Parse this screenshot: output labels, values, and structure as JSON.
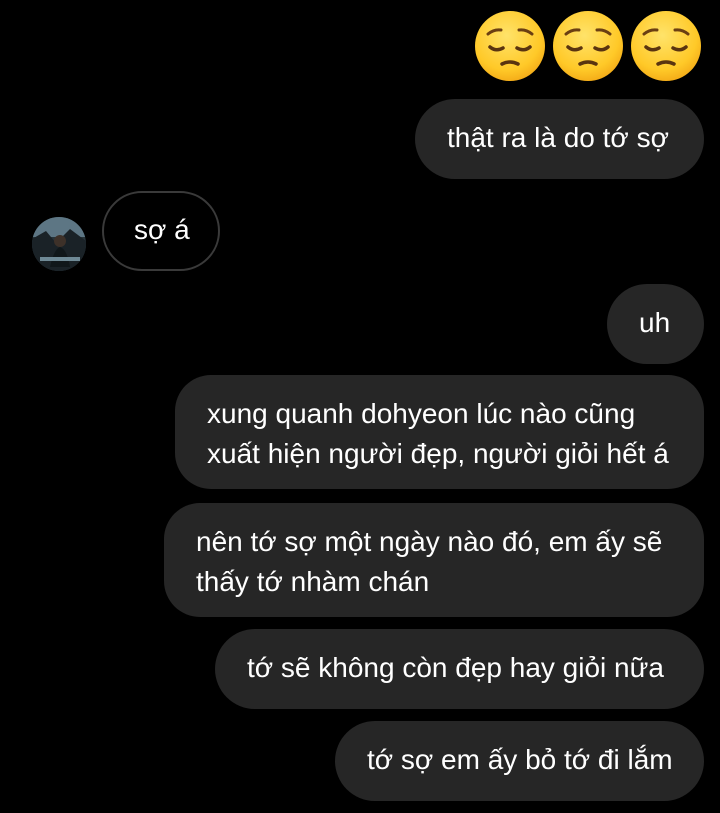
{
  "conversation": {
    "emoji_reaction": [
      "😔",
      "😔",
      "😔"
    ],
    "messages": [
      {
        "sender": "me",
        "text": "thật ra là do tớ sợ"
      },
      {
        "sender": "other",
        "text": "sợ á"
      },
      {
        "sender": "me",
        "text": "uh"
      },
      {
        "sender": "me",
        "lines": [
          "xung quanh dohyeon lúc nào cũng",
          "xuất hiện người đẹp, người giỏi hết á"
        ]
      },
      {
        "sender": "me",
        "lines": [
          "nên tớ sợ một ngày nào đó, em ấy sẽ",
          "thấy tớ nhàm chán"
        ]
      },
      {
        "sender": "me",
        "text": "tớ sẽ không còn đẹp hay giỏi nữa"
      },
      {
        "sender": "me",
        "text": "tớ sợ em ấy bỏ tớ đi lắm"
      }
    ]
  },
  "colors": {
    "background": "#000000",
    "outgoing_bubble": "#262626",
    "incoming_border": "#3a3a3a",
    "text": "#ffffff"
  },
  "icons": {
    "reaction": "pensive-face-icon",
    "avatar": "contact-avatar"
  }
}
